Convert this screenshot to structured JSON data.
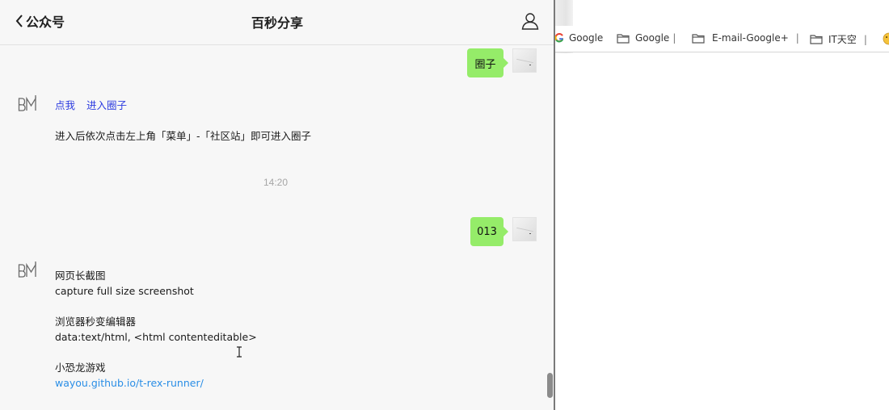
{
  "header": {
    "back_label": "公众号",
    "title": "百秒分享"
  },
  "messages": {
    "outgoing_1": "圈子",
    "incoming_1": {
      "link_me": "点我",
      "link_enter": "进入圈子",
      "instruction": "进入后依次点击左上角「菜单」-「社区站」即可进入圈子"
    },
    "timestamp": "14:20",
    "outgoing_2": "013",
    "incoming_2": {
      "line1": "网页长截图",
      "line2": "capture full size screenshot",
      "line3": "浏览器秒变编辑器",
      "line4": "data:text/html, <html contenteditable>",
      "line5": "小恐龙游戏",
      "line6": "wayou.github.io/t-rex-runner/"
    }
  },
  "bookmarks": {
    "items": [
      {
        "label": "Google",
        "icon": "google-icon"
      },
      {
        "label": "Google",
        "icon": "folder-icon"
      },
      {
        "label": "E-mail-Google+",
        "icon": "folder-icon"
      },
      {
        "label": "IT天空",
        "icon": "folder-icon"
      }
    ]
  },
  "colors": {
    "outgoing_bubble": "#95ec69",
    "link_blue": "#2c3be0",
    "url_blue": "#2a8ee6",
    "chat_bg": "#f7f7f7"
  }
}
